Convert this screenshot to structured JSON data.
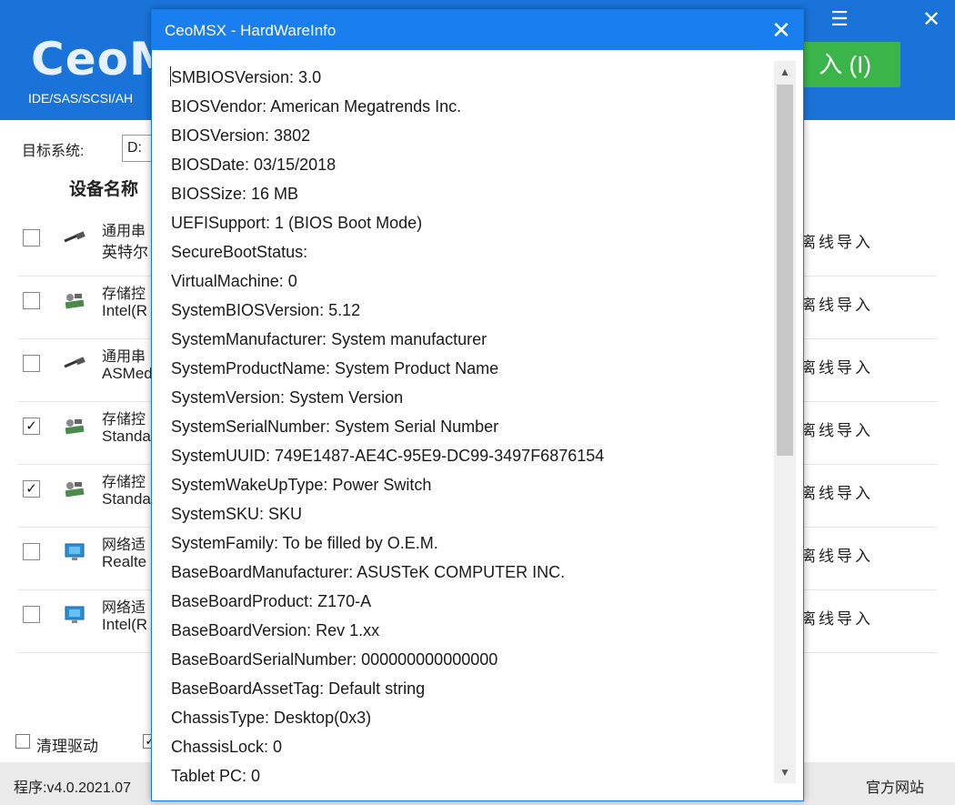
{
  "main": {
    "logo": "CeoM",
    "subtitle": "IDE/SAS/SCSI/AH",
    "import_button": "入 (I)",
    "target_label": "目标系统:",
    "target_value": "D:",
    "column_device": "设备名称",
    "devices": [
      {
        "category": "通用串",
        "name": "英特尔",
        "checked": false,
        "icon": "usb-cable-icon",
        "action": "离线导入"
      },
      {
        "category": "存储控",
        "name": "Intel(R",
        "checked": false,
        "icon": "storage-controller-icon",
        "action": "离线导入"
      },
      {
        "category": "通用串",
        "name": "ASMed",
        "checked": false,
        "icon": "usb-cable-icon",
        "action": "离线导入"
      },
      {
        "category": "存储控",
        "name": "Standa",
        "checked": true,
        "icon": "storage-controller-icon",
        "action": "离线导入"
      },
      {
        "category": "存储控",
        "name": "Standa",
        "checked": true,
        "icon": "storage-controller-icon",
        "action": "离线导入"
      },
      {
        "category": "网络适",
        "name": "Realte",
        "checked": false,
        "icon": "network-monitor-icon",
        "action": "离线导入"
      },
      {
        "category": "网络适",
        "name": "Intel(R",
        "checked": false,
        "icon": "network-monitor-icon",
        "action": "离线导入"
      }
    ],
    "clean_driver_label": "清理驱动",
    "version": "程序:v4.0.2021.07",
    "website": "官方网站"
  },
  "dialog": {
    "title": "CeoMSX - HardWareInfo",
    "lines": [
      "SMBIOSVersion: 3.0",
      "BIOSVendor: American Megatrends Inc.",
      "BIOSVersion: 3802",
      "BIOSDate: 03/15/2018",
      "BIOSSize: 16 MB",
      "UEFISupport: 1 (BIOS Boot Mode)",
      "SecureBootStatus:",
      "VirtualMachine: 0",
      "SystemBIOSVersion: 5.12",
      "SystemManufacturer: System manufacturer",
      "SystemProductName: System Product Name",
      "SystemVersion: System Version",
      "SystemSerialNumber: System Serial Number",
      "SystemUUID: 749E1487-AE4C-95E9-DC99-3497F6876154",
      "SystemWakeUpType: Power Switch",
      "SystemSKU: SKU",
      "SystemFamily: To be filled by O.E.M.",
      "BaseBoardManufacturer: ASUSTeK COMPUTER INC.",
      "BaseBoardProduct: Z170-A",
      "BaseBoardVersion: Rev 1.xx",
      "BaseBoardSerialNumber: 000000000000000",
      "BaseBoardAssetTag: Default string",
      "ChassisType: Desktop(0x3)",
      "ChassisLock: 0",
      "Tablet PC: 0"
    ],
    "scroll_fraction_visible": 0.55
  },
  "colors": {
    "header_blue": "#1a73d9",
    "dialog_blue": "#1a7fee",
    "import_green": "#3bb54a"
  }
}
